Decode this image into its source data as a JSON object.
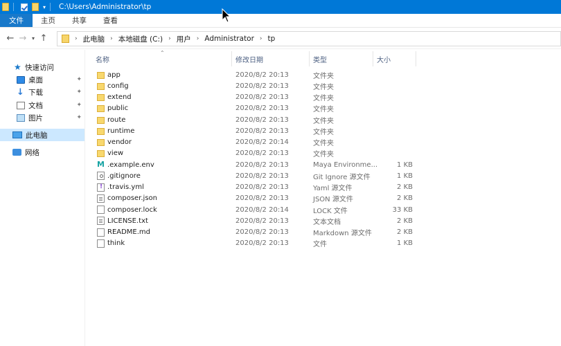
{
  "titlebar": {
    "path": "C:\\Users\\Administrator\\tp"
  },
  "ribbon": {
    "tabs": [
      "文件",
      "主页",
      "共享",
      "查看"
    ]
  },
  "address": {
    "crumbs": [
      "此电脑",
      "本地磁盘 (C:)",
      "用户",
      "Administrator",
      "tp"
    ]
  },
  "sidebar": {
    "quick_access": "快速访问",
    "items": [
      "桌面",
      "下载",
      "文档",
      "图片"
    ],
    "this_pc": "此电脑",
    "network": "网络"
  },
  "columns": {
    "name": "名称",
    "date": "修改日期",
    "type": "类型",
    "size": "大小"
  },
  "files": [
    {
      "name": "app",
      "date": "2020/8/2 20:13",
      "type": "文件夹",
      "size": "",
      "icon": "folder-icon"
    },
    {
      "name": "config",
      "date": "2020/8/2 20:13",
      "type": "文件夹",
      "size": "",
      "icon": "folder-icon"
    },
    {
      "name": "extend",
      "date": "2020/8/2 20:13",
      "type": "文件夹",
      "size": "",
      "icon": "folder-icon"
    },
    {
      "name": "public",
      "date": "2020/8/2 20:13",
      "type": "文件夹",
      "size": "",
      "icon": "folder-icon"
    },
    {
      "name": "route",
      "date": "2020/8/2 20:13",
      "type": "文件夹",
      "size": "",
      "icon": "folder-icon"
    },
    {
      "name": "runtime",
      "date": "2020/8/2 20:13",
      "type": "文件夹",
      "size": "",
      "icon": "folder-icon"
    },
    {
      "name": "vendor",
      "date": "2020/8/2 20:14",
      "type": "文件夹",
      "size": "",
      "icon": "folder-icon"
    },
    {
      "name": "view",
      "date": "2020/8/2 20:13",
      "type": "文件夹",
      "size": "",
      "icon": "folder-icon"
    },
    {
      "name": ".example.env",
      "date": "2020/8/2 20:13",
      "type": "Maya Environme...",
      "size": "1 KB",
      "icon": "maya-icon"
    },
    {
      "name": ".gitignore",
      "date": "2020/8/2 20:13",
      "type": "Git Ignore 源文件",
      "size": "1 KB",
      "icon": "gear-file-icon"
    },
    {
      "name": ".travis.yml",
      "date": "2020/8/2 20:13",
      "type": "Yaml 源文件",
      "size": "2 KB",
      "icon": "yaml-file-icon"
    },
    {
      "name": "composer.json",
      "date": "2020/8/2 20:13",
      "type": "JSON 源文件",
      "size": "2 KB",
      "icon": "json-file-icon"
    },
    {
      "name": "composer.lock",
      "date": "2020/8/2 20:14",
      "type": "LOCK 文件",
      "size": "33 KB",
      "icon": "file-icon"
    },
    {
      "name": "LICENSE.txt",
      "date": "2020/8/2 20:13",
      "type": "文本文档",
      "size": "2 KB",
      "icon": "text-file-icon"
    },
    {
      "name": "README.md",
      "date": "2020/8/2 20:13",
      "type": "Markdown 源文件",
      "size": "2 KB",
      "icon": "markdown-file-icon"
    },
    {
      "name": "think",
      "date": "2020/8/2 20:13",
      "type": "文件",
      "size": "1 KB",
      "icon": "file-icon"
    }
  ]
}
